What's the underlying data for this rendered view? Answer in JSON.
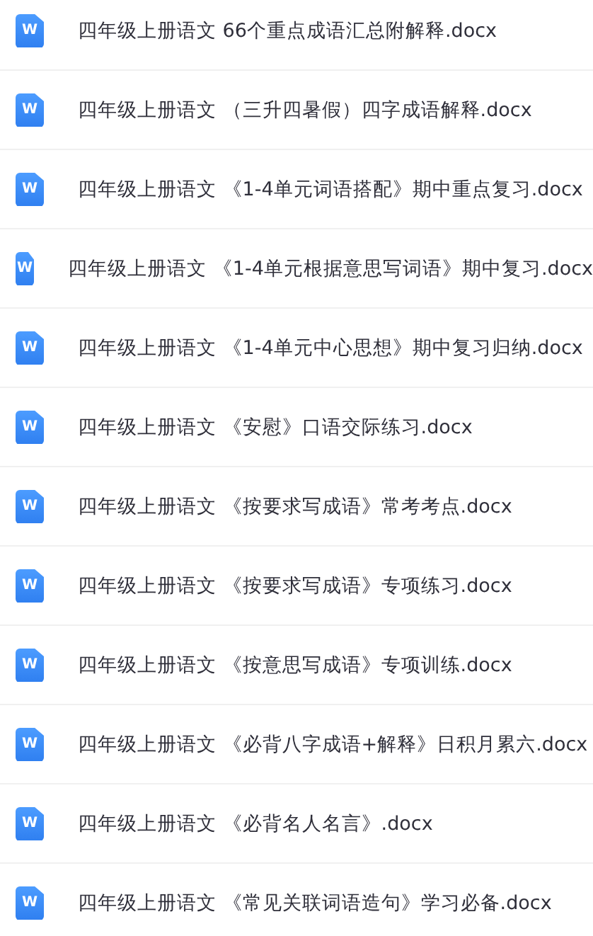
{
  "files": [
    {
      "name": "四年级上册语文 66个重点成语汇总附解释.docx",
      "icon_label": "W"
    },
    {
      "name": "四年级上册语文 （三升四暑假）四字成语解释.docx",
      "icon_label": "W"
    },
    {
      "name": "四年级上册语文 《1-4单元词语搭配》期中重点复习.docx",
      "icon_label": "W"
    },
    {
      "name": "四年级上册语文 《1-4单元根据意思写词语》期中复习.docx",
      "icon_label": "W"
    },
    {
      "name": "四年级上册语文 《1-4单元中心思想》期中复习归纳.docx",
      "icon_label": "W"
    },
    {
      "name": "四年级上册语文 《安慰》口语交际练习.docx",
      "icon_label": "W"
    },
    {
      "name": "四年级上册语文 《按要求写成语》常考考点.docx",
      "icon_label": "W"
    },
    {
      "name": "四年级上册语文 《按要求写成语》专项练习.docx",
      "icon_label": "W"
    },
    {
      "name": "四年级上册语文 《按意思写成语》专项训练.docx",
      "icon_label": "W"
    },
    {
      "name": "四年级上册语文 《必背八字成语+解释》日积月累六.docx",
      "icon_label": "W"
    },
    {
      "name": "四年级上册语文 《必背名人名言》.docx",
      "icon_label": "W"
    },
    {
      "name": "四年级上册语文 《常见关联词语造句》学习必备.docx",
      "icon_label": "W"
    }
  ]
}
